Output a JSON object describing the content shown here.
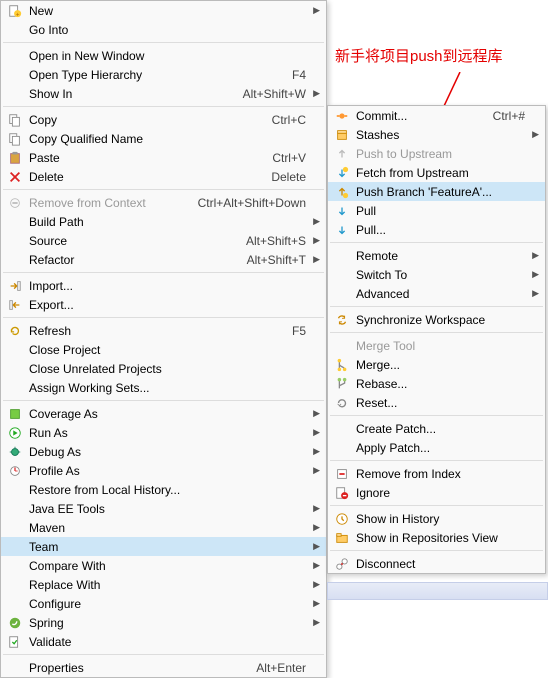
{
  "annotation": "新手将项目push到远程库",
  "left_menu": [
    {
      "type": "item",
      "icon": "new",
      "label": "New",
      "arrow": true
    },
    {
      "type": "item",
      "icon": "",
      "label": "Go Into"
    },
    {
      "type": "sep"
    },
    {
      "type": "item",
      "icon": "",
      "label": "Open in New Window"
    },
    {
      "type": "item",
      "icon": "",
      "label": "Open Type Hierarchy",
      "shortcut": "F4"
    },
    {
      "type": "item",
      "icon": "",
      "label": "Show In",
      "shortcut": "Alt+Shift+W",
      "arrow": true
    },
    {
      "type": "sep"
    },
    {
      "type": "item",
      "icon": "copy",
      "label": "Copy",
      "shortcut": "Ctrl+C"
    },
    {
      "type": "item",
      "icon": "copy",
      "label": "Copy Qualified Name"
    },
    {
      "type": "item",
      "icon": "paste",
      "label": "Paste",
      "shortcut": "Ctrl+V"
    },
    {
      "type": "item",
      "icon": "delete",
      "label": "Delete",
      "shortcut": "Delete"
    },
    {
      "type": "sep"
    },
    {
      "type": "item",
      "icon": "remove",
      "label": "Remove from Context",
      "shortcut": "Ctrl+Alt+Shift+Down",
      "disabled": true
    },
    {
      "type": "item",
      "icon": "",
      "label": "Build Path",
      "arrow": true
    },
    {
      "type": "item",
      "icon": "",
      "label": "Source",
      "shortcut": "Alt+Shift+S",
      "arrow": true
    },
    {
      "type": "item",
      "icon": "",
      "label": "Refactor",
      "shortcut": "Alt+Shift+T",
      "arrow": true
    },
    {
      "type": "sep"
    },
    {
      "type": "item",
      "icon": "import",
      "label": "Import..."
    },
    {
      "type": "item",
      "icon": "export",
      "label": "Export..."
    },
    {
      "type": "sep"
    },
    {
      "type": "item",
      "icon": "refresh",
      "label": "Refresh",
      "shortcut": "F5"
    },
    {
      "type": "item",
      "icon": "",
      "label": "Close Project"
    },
    {
      "type": "item",
      "icon": "",
      "label": "Close Unrelated Projects"
    },
    {
      "type": "item",
      "icon": "",
      "label": "Assign Working Sets..."
    },
    {
      "type": "sep"
    },
    {
      "type": "item",
      "icon": "coverage",
      "label": "Coverage As",
      "arrow": true
    },
    {
      "type": "item",
      "icon": "run",
      "label": "Run As",
      "arrow": true
    },
    {
      "type": "item",
      "icon": "debug",
      "label": "Debug As",
      "arrow": true
    },
    {
      "type": "item",
      "icon": "profile",
      "label": "Profile As",
      "arrow": true
    },
    {
      "type": "item",
      "icon": "",
      "label": "Restore from Local History..."
    },
    {
      "type": "item",
      "icon": "",
      "label": "Java EE Tools",
      "arrow": true
    },
    {
      "type": "item",
      "icon": "",
      "label": "Maven",
      "arrow": true
    },
    {
      "type": "item",
      "icon": "",
      "label": "Team",
      "arrow": true,
      "highlighted": true
    },
    {
      "type": "item",
      "icon": "",
      "label": "Compare With",
      "arrow": true
    },
    {
      "type": "item",
      "icon": "",
      "label": "Replace With",
      "arrow": true
    },
    {
      "type": "item",
      "icon": "",
      "label": "Configure",
      "arrow": true
    },
    {
      "type": "item",
      "icon": "spring",
      "label": "Spring",
      "arrow": true
    },
    {
      "type": "item",
      "icon": "validate",
      "label": "Validate"
    },
    {
      "type": "sep"
    },
    {
      "type": "item",
      "icon": "",
      "label": "Properties",
      "shortcut": "Alt+Enter"
    }
  ],
  "right_menu": [
    {
      "type": "item",
      "icon": "commit",
      "label": "Commit...",
      "shortcut": "Ctrl+#"
    },
    {
      "type": "item",
      "icon": "stash",
      "label": "Stashes",
      "arrow": true
    },
    {
      "type": "item",
      "icon": "push-up",
      "label": "Push to Upstream",
      "disabled": true
    },
    {
      "type": "item",
      "icon": "fetch",
      "label": "Fetch from Upstream"
    },
    {
      "type": "item",
      "icon": "push",
      "label": "Push Branch 'FeatureA'...",
      "highlighted": true
    },
    {
      "type": "item",
      "icon": "pull",
      "label": "Pull"
    },
    {
      "type": "item",
      "icon": "pull",
      "label": "Pull..."
    },
    {
      "type": "sep"
    },
    {
      "type": "item",
      "icon": "",
      "label": "Remote",
      "arrow": true
    },
    {
      "type": "item",
      "icon": "",
      "label": "Switch To",
      "arrow": true
    },
    {
      "type": "item",
      "icon": "",
      "label": "Advanced",
      "arrow": true
    },
    {
      "type": "sep"
    },
    {
      "type": "item",
      "icon": "sync",
      "label": "Synchronize Workspace"
    },
    {
      "type": "sep"
    },
    {
      "type": "item",
      "icon": "",
      "label": "Merge Tool",
      "disabled": true
    },
    {
      "type": "item",
      "icon": "merge",
      "label": "Merge..."
    },
    {
      "type": "item",
      "icon": "rebase",
      "label": "Rebase..."
    },
    {
      "type": "item",
      "icon": "reset",
      "label": "Reset..."
    },
    {
      "type": "sep"
    },
    {
      "type": "item",
      "icon": "",
      "label": "Create Patch..."
    },
    {
      "type": "item",
      "icon": "",
      "label": "Apply Patch..."
    },
    {
      "type": "sep"
    },
    {
      "type": "item",
      "icon": "remove-idx",
      "label": "Remove from Index"
    },
    {
      "type": "item",
      "icon": "ignore",
      "label": "Ignore"
    },
    {
      "type": "sep"
    },
    {
      "type": "item",
      "icon": "history",
      "label": "Show in History"
    },
    {
      "type": "item",
      "icon": "repo",
      "label": "Show in Repositories View"
    },
    {
      "type": "sep"
    },
    {
      "type": "item",
      "icon": "disconnect",
      "label": "Disconnect"
    }
  ]
}
